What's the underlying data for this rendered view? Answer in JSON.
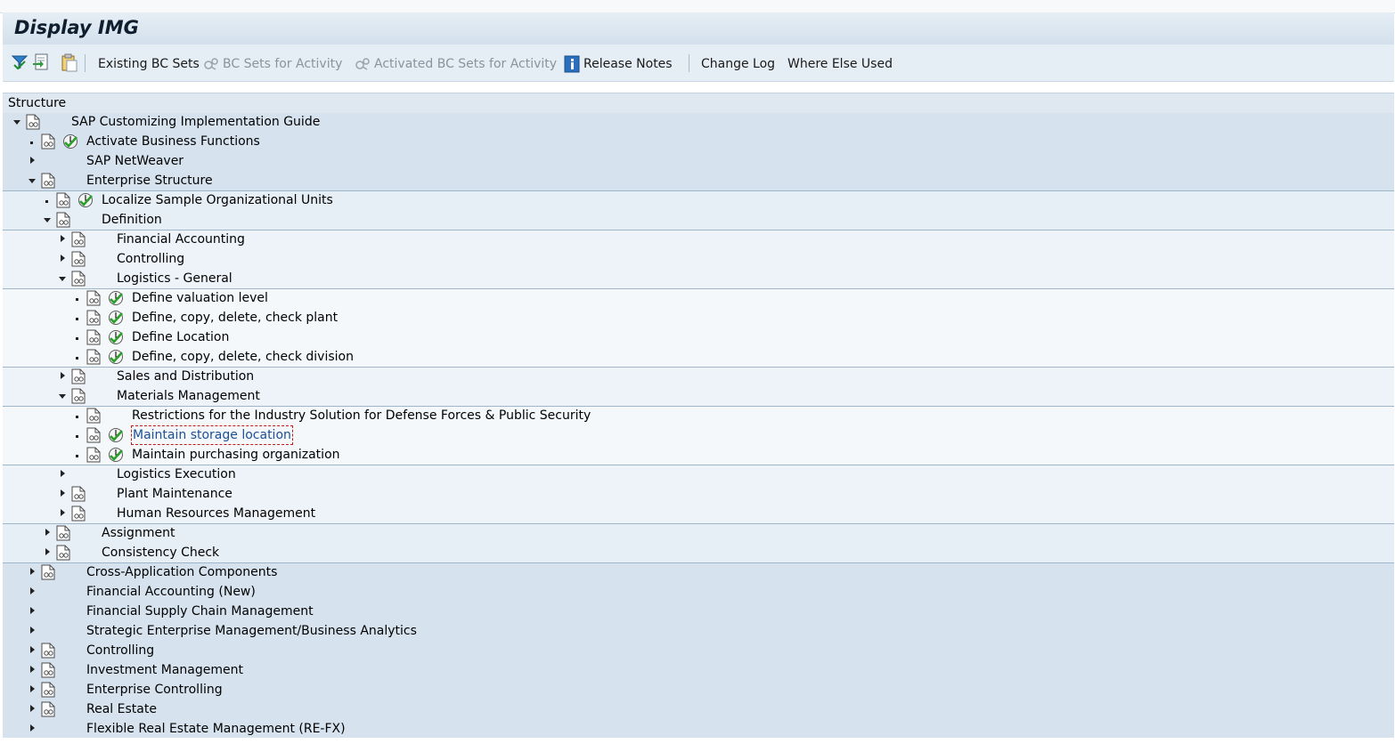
{
  "window": {
    "title": "Display IMG"
  },
  "toolbar": {
    "icons": [
      "filter-icon",
      "import-icon",
      "clipboard-icon"
    ],
    "buttons": [
      {
        "label": "Existing BC Sets",
        "enabled": true,
        "icon": ""
      },
      {
        "label": "BC Sets for Activity",
        "enabled": false,
        "icon": "bcset-icon"
      },
      {
        "label": "Activated BC Sets for Activity",
        "enabled": false,
        "icon": "bcset-icon"
      },
      {
        "label": "Release Notes",
        "enabled": true,
        "icon": "info-icon"
      },
      {
        "label": "Change Log",
        "enabled": true,
        "icon": ""
      },
      {
        "label": "Where Else Used",
        "enabled": true,
        "icon": ""
      }
    ]
  },
  "tree": {
    "header": "Structure",
    "rows": [
      {
        "label": "SAP Customizing Implementation Guide",
        "level": 0,
        "expander": "expanded",
        "doc": true,
        "activity": false
      },
      {
        "label": "Activate Business Functions",
        "level": 1,
        "expander": "leaf",
        "doc": true,
        "activity": true
      },
      {
        "label": "SAP NetWeaver",
        "level": 1,
        "expander": "collapsed",
        "doc": false,
        "activity": false
      },
      {
        "label": "Enterprise Structure",
        "level": 1,
        "expander": "expanded",
        "doc": true,
        "activity": false
      },
      {
        "label": "Localize Sample Organizational Units",
        "level": 2,
        "expander": "leaf",
        "doc": true,
        "activity": true
      },
      {
        "label": "Definition",
        "level": 2,
        "expander": "expanded",
        "doc": true,
        "activity": false
      },
      {
        "label": "Financial Accounting",
        "level": 3,
        "expander": "collapsed",
        "doc": true,
        "activity": false
      },
      {
        "label": "Controlling",
        "level": 3,
        "expander": "collapsed",
        "doc": true,
        "activity": false
      },
      {
        "label": "Logistics - General",
        "level": 3,
        "expander": "expanded",
        "doc": true,
        "activity": false
      },
      {
        "label": "Define valuation level",
        "level": 4,
        "expander": "leaf",
        "doc": true,
        "activity": true
      },
      {
        "label": "Define, copy, delete, check plant",
        "level": 4,
        "expander": "leaf",
        "doc": true,
        "activity": true
      },
      {
        "label": "Define Location",
        "level": 4,
        "expander": "leaf",
        "doc": true,
        "activity": true
      },
      {
        "label": "Define, copy, delete, check division",
        "level": 4,
        "expander": "leaf",
        "doc": true,
        "activity": true
      },
      {
        "label": "Sales and Distribution",
        "level": 3,
        "expander": "collapsed",
        "doc": true,
        "activity": false
      },
      {
        "label": "Materials Management",
        "level": 3,
        "expander": "expanded",
        "doc": true,
        "activity": false
      },
      {
        "label": "Restrictions for the Industry Solution for Defense Forces & Public Security",
        "level": 4,
        "expander": "leaf",
        "doc": true,
        "activity": false
      },
      {
        "label": "Maintain storage location",
        "level": 4,
        "expander": "leaf",
        "doc": true,
        "activity": true,
        "focused": true
      },
      {
        "label": "Maintain purchasing organization",
        "level": 4,
        "expander": "leaf",
        "doc": true,
        "activity": true
      },
      {
        "label": "Logistics Execution",
        "level": 3,
        "expander": "collapsed",
        "doc": false,
        "activity": false
      },
      {
        "label": "Plant Maintenance",
        "level": 3,
        "expander": "collapsed",
        "doc": true,
        "activity": false
      },
      {
        "label": "Human Resources Management",
        "level": 3,
        "expander": "collapsed",
        "doc": true,
        "activity": false
      },
      {
        "label": "Assignment",
        "level": 2,
        "expander": "collapsed",
        "doc": true,
        "activity": false
      },
      {
        "label": "Consistency Check",
        "level": 2,
        "expander": "collapsed",
        "doc": true,
        "activity": false
      },
      {
        "label": "Cross-Application Components",
        "level": 1,
        "expander": "collapsed",
        "doc": true,
        "activity": false
      },
      {
        "label": "Financial Accounting (New)",
        "level": 1,
        "expander": "collapsed",
        "doc": false,
        "activity": false
      },
      {
        "label": "Financial Supply Chain Management",
        "level": 1,
        "expander": "collapsed",
        "doc": false,
        "activity": false
      },
      {
        "label": "Strategic Enterprise Management/Business Analytics",
        "level": 1,
        "expander": "collapsed",
        "doc": false,
        "activity": false
      },
      {
        "label": "Controlling",
        "level": 1,
        "expander": "collapsed",
        "doc": true,
        "activity": false
      },
      {
        "label": "Investment Management",
        "level": 1,
        "expander": "collapsed",
        "doc": true,
        "activity": false
      },
      {
        "label": "Enterprise Controlling",
        "level": 1,
        "expander": "collapsed",
        "doc": true,
        "activity": false
      },
      {
        "label": "Real Estate",
        "level": 1,
        "expander": "collapsed",
        "doc": true,
        "activity": false
      },
      {
        "label": "Flexible Real Estate Management (RE-FX)",
        "level": 1,
        "expander": "collapsed",
        "doc": false,
        "activity": false
      }
    ]
  }
}
